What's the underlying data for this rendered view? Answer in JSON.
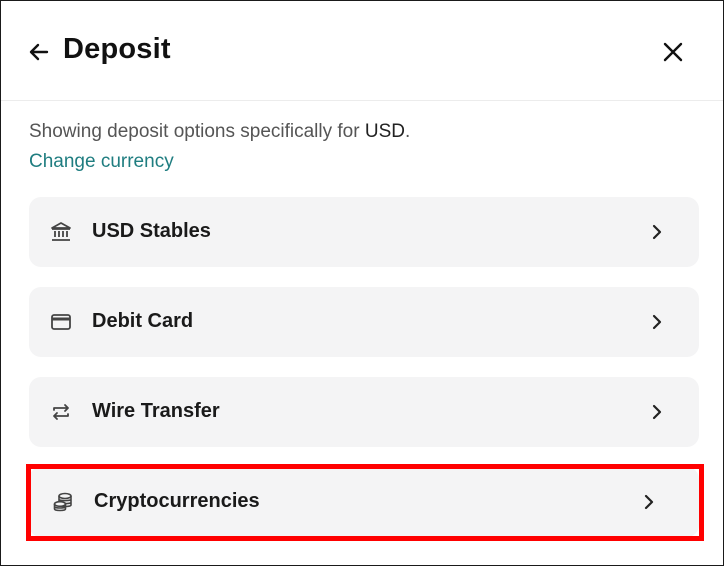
{
  "header": {
    "title": "Deposit",
    "back_icon": "arrow-left-icon",
    "close_icon": "close-icon"
  },
  "description": {
    "prefix": "Showing deposit options specifically for ",
    "currency": "USD",
    "suffix": "."
  },
  "change_currency_label": "Change currency",
  "options": [
    {
      "label": "USD Stables",
      "icon": "bank-icon"
    },
    {
      "label": "Debit Card",
      "icon": "credit-card-icon"
    },
    {
      "label": "Wire Transfer",
      "icon": "transfer-arrows-icon"
    },
    {
      "label": "Cryptocurrencies",
      "icon": "coins-stack-icon"
    }
  ],
  "colors": {
    "accent_link": "#1f7d80",
    "option_bg": "#f4f4f5",
    "highlight": "#ff0000"
  }
}
